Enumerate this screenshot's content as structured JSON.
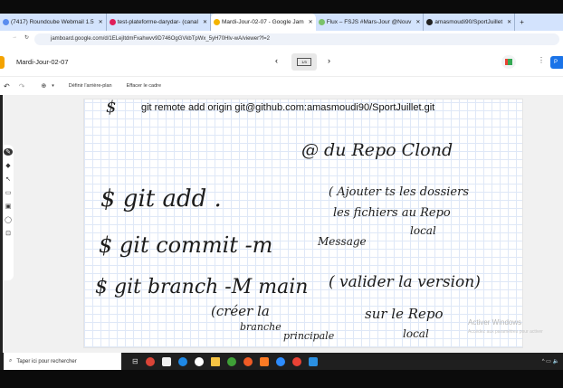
{
  "browser": {
    "tabs": [
      {
        "label": "(7417) Roundcube Webmail 1.5",
        "color": "#5b8def"
      },
      {
        "label": "test-plateforme-darydar- (canal",
        "color": "#e01e5a"
      },
      {
        "label": "Mardi-Jour-02-07 - Google Jam",
        "color": "#f4b400",
        "active": true
      },
      {
        "label": "Flux – FSJS #Mars-Jour @Nouv",
        "color": "#7ac26b"
      },
      {
        "label": "amasmoudi90/SportJuillet",
        "color": "#222222"
      }
    ],
    "new_tab": "+",
    "url": "jamboard.google.com/d/1ELejItdmFxahwvv9D746OgGVkbTpWx_5yH70Hlv-wA/viewer?f=2"
  },
  "app": {
    "title": "Mardi-Jour-02-07",
    "frame_indicator": "1/3",
    "share_label": "P",
    "toolbar": {
      "set_background": "Définir l'arrière-plan",
      "clear_frame": "Effacer le cadre"
    }
  },
  "canvas": {
    "typed": "git remote add origin git@github.com:amasmoudi90/SportJuillet.git",
    "handwriting": {
      "dollar1": "$",
      "note1": "@ du Repo Clond",
      "line1": "$  git  add   .",
      "note2a": "( Ajouter ts les dossiers",
      "note2b": "les fichiers au Repo",
      "note2c": "local",
      "line2": "$ git  commit  -m",
      "note3": "Message",
      "line3": "$ git branch -M main",
      "note4": "( valider la version)",
      "note5a": "(créer la",
      "note5b": "branche",
      "note5c": "principale",
      "note5d": "sur le Repo",
      "note5e": "local"
    }
  },
  "watermark": {
    "title": "Activer Windows",
    "subtitle": "Accédez aux paramètres pour activer"
  },
  "taskbar": {
    "search_placeholder": "Taper ici pour rechercher",
    "apps": [
      {
        "name": "chrome",
        "color": "#db4437"
      },
      {
        "name": "store",
        "color": "#f0f0f0"
      },
      {
        "name": "edge",
        "color": "#1e88e5"
      },
      {
        "name": "wamp",
        "color": "#ffffff"
      },
      {
        "name": "explorer",
        "color": "#f6c343"
      },
      {
        "name": "mongodb-compass",
        "color": "#3fa037"
      },
      {
        "name": "postman",
        "color": "#ef5b25"
      },
      {
        "name": "xampp",
        "color": "#fb7a24"
      },
      {
        "name": "zoom",
        "color": "#2d8cff"
      },
      {
        "name": "chrome-profile",
        "color": "#e94235"
      },
      {
        "name": "vscode",
        "color": "#2b8fe0"
      }
    ]
  }
}
